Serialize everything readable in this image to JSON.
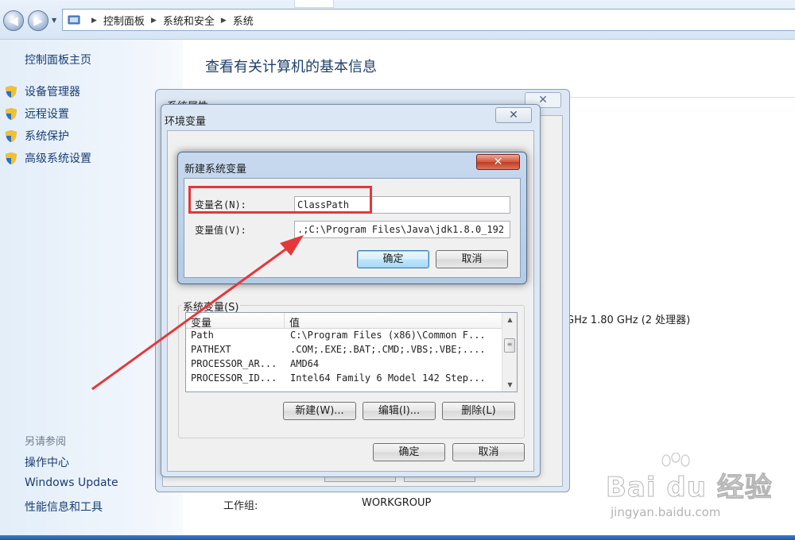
{
  "breadcrumb": {
    "items": [
      "控制面板",
      "系统和安全",
      "系统"
    ]
  },
  "leftnav": {
    "home": "控制面板主页",
    "items": [
      "设备管理器",
      "远程设置",
      "系统保护",
      "高级系统设置"
    ],
    "see_also_title": "另请参阅",
    "see_also": [
      "操作中心",
      "Windows Update",
      "性能信息和工具"
    ]
  },
  "main": {
    "title": "查看有关计算机的基本信息",
    "cpu_fragment": "GHz   1.80 GHz  (2 处理器)",
    "workgroup_label": "工作组:",
    "workgroup_value": "WORKGROUP"
  },
  "sysprop": {
    "title": "系统属性",
    "close": "✕"
  },
  "envvars": {
    "title": "环境变量",
    "close": "✕",
    "system_vars_label": "系统变量(S)",
    "columns": [
      "变量",
      "值"
    ],
    "rows": [
      {
        "name": "Path",
        "value": "C:\\Program Files (x86)\\Common F..."
      },
      {
        "name": "PATHEXT",
        "value": ".COM;.EXE;.BAT;.CMD;.VBS;.VBE;...."
      },
      {
        "name": "PROCESSOR_AR...",
        "value": "AMD64"
      },
      {
        "name": "PROCESSOR_ID...",
        "value": "Intel64 Family 6 Model 142 Step..."
      }
    ],
    "new_button": "新建(W)...",
    "edit_button": "编辑(I)...",
    "delete_button": "删除(L)",
    "ok_button": "确定",
    "cancel_button": "取消"
  },
  "new_var": {
    "title": "新建系统变量",
    "close": "✕",
    "name_label": "变量名(N):",
    "name_value": "ClassPath",
    "value_label": "变量值(V):",
    "value_value": ".;C:\\Program Files\\Java\\jdk1.8.0_192",
    "ok_button": "确定",
    "cancel_button": "取消"
  },
  "watermark": {
    "brand": "Bai du 经验",
    "url": "jingyan.baidu.com"
  },
  "colors": {
    "highlight_red": "#e5373a",
    "link_blue": "#1a3e73"
  }
}
